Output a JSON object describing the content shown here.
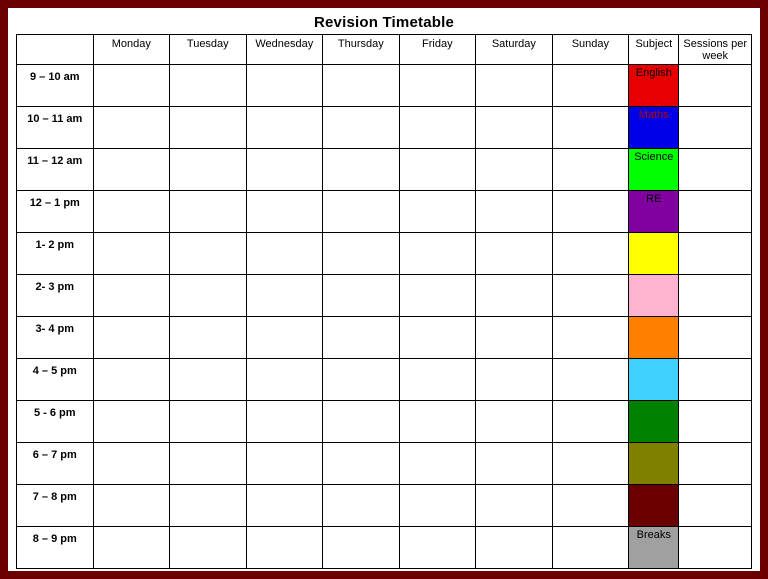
{
  "title": "Revision Timetable",
  "headers": {
    "blank": "",
    "days": [
      "Monday",
      "Tuesday",
      "Wednesday",
      "Thursday",
      "Friday",
      "Saturday",
      "Sunday"
    ],
    "subject": "Subject",
    "sessions": "Sessions per week"
  },
  "rows": [
    {
      "time": "9 – 10 am",
      "subject": {
        "label": "English",
        "bg": "#e60000",
        "fg": "#000000"
      }
    },
    {
      "time": "10 – 11 am",
      "subject": {
        "label": "Maths",
        "bg": "#0000e6",
        "fg": "#b30000"
      }
    },
    {
      "time": "11 – 12 am",
      "subject": {
        "label": "Science",
        "bg": "#00ff00",
        "fg": "#000000"
      }
    },
    {
      "time": "12 – 1 pm",
      "subject": {
        "label": "RE",
        "bg": "#8000a0",
        "fg": "#000000"
      }
    },
    {
      "time": "1- 2 pm",
      "subject": {
        "label": "",
        "bg": "#ffff00",
        "fg": "#000000"
      }
    },
    {
      "time": "2- 3 pm",
      "subject": {
        "label": "",
        "bg": "#ffb3d1",
        "fg": "#000000"
      }
    },
    {
      "time": "3- 4 pm",
      "subject": {
        "label": "",
        "bg": "#ff8000",
        "fg": "#000000"
      }
    },
    {
      "time": "4 – 5 pm",
      "subject": {
        "label": "",
        "bg": "#40d0ff",
        "fg": "#000000"
      }
    },
    {
      "time": "5 - 6 pm",
      "subject": {
        "label": "",
        "bg": "#008000",
        "fg": "#000000"
      }
    },
    {
      "time": "6 – 7 pm",
      "subject": {
        "label": "",
        "bg": "#808000",
        "fg": "#000000"
      }
    },
    {
      "time": "7 – 8 pm",
      "subject": {
        "label": "",
        "bg": "#6b0000",
        "fg": "#000000"
      }
    },
    {
      "time": "8 – 9 pm",
      "subject": {
        "label": "Breaks",
        "bg": "#a0a0a0",
        "fg": "#000000"
      }
    }
  ]
}
